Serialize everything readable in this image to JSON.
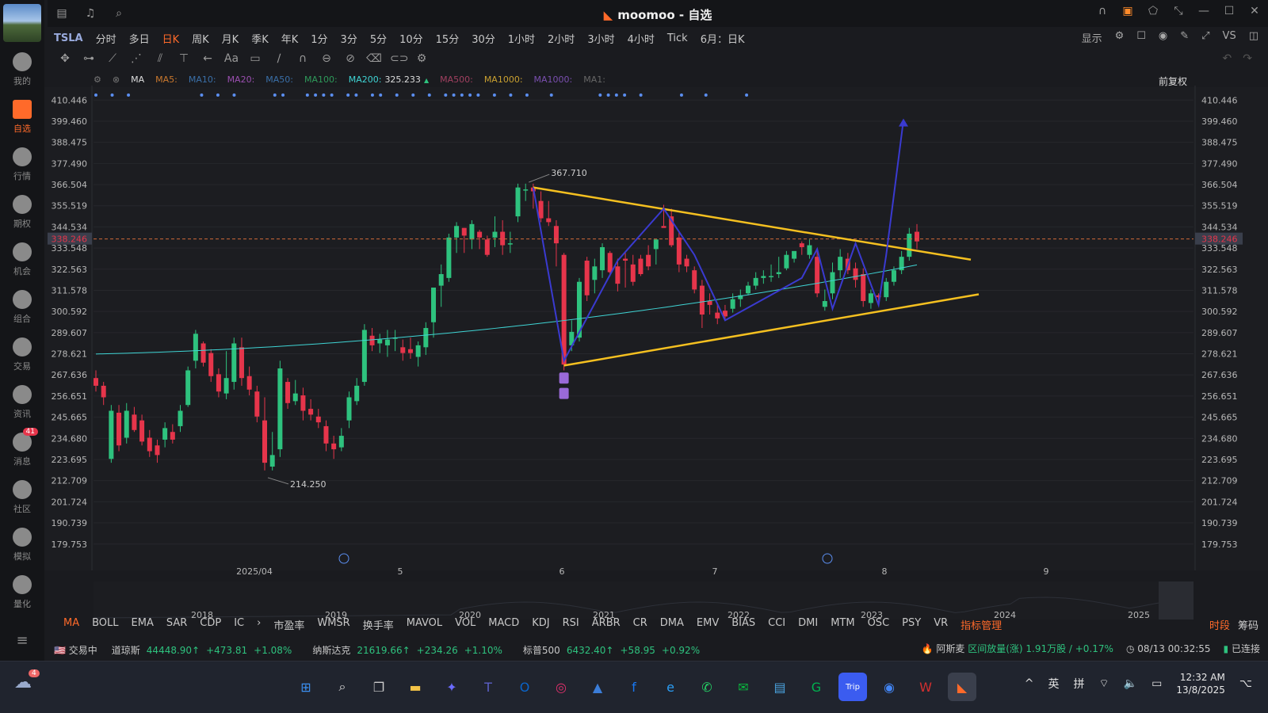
{
  "window": {
    "title": "moomoo - 自选",
    "logo": "moomoo-logo-icon"
  },
  "sidebar": {
    "items": [
      {
        "label": "我的",
        "icon": "user-icon"
      },
      {
        "label": "自选",
        "icon": "watchlist-bar-icon",
        "active": true
      },
      {
        "label": "行情",
        "icon": "market-icon"
      },
      {
        "label": "期权",
        "icon": "options-icon"
      },
      {
        "label": "机会",
        "icon": "funnel-icon"
      },
      {
        "label": "组合",
        "icon": "pie-icon"
      },
      {
        "label": "交易",
        "icon": "trade-icon"
      },
      {
        "label": "资讯",
        "icon": "news-icon"
      },
      {
        "label": "消息",
        "icon": "message-icon",
        "badge": "41"
      },
      {
        "label": "社区",
        "icon": "community-icon"
      },
      {
        "label": "模拟",
        "icon": "game-icon"
      },
      {
        "label": "量化",
        "icon": "code-icon"
      }
    ]
  },
  "toolbar": {
    "symbol": "TSLA",
    "timeframes": [
      "分时",
      "多日",
      "日K",
      "周K",
      "月K",
      "季K",
      "年K",
      "1分",
      "3分",
      "5分",
      "10分",
      "15分",
      "30分",
      "1小时",
      "2小时",
      "3小时",
      "4小时",
      "Tick",
      "6月：日K"
    ],
    "active_timeframe": "日K",
    "display_label": "显示",
    "vs_label": "VS"
  },
  "ma_legend": {
    "ma_label": "MA",
    "items": [
      {
        "label": "MA5:",
        "color": "#c9782e"
      },
      {
        "label": "MA10:",
        "color": "#3a6fa8"
      },
      {
        "label": "MA20:",
        "color": "#9a4fb0"
      },
      {
        "label": "MA50:",
        "color": "#3a6fa8"
      },
      {
        "label": "MA100:",
        "color": "#2e9a5a"
      },
      {
        "label": "MA200:",
        "value": "325.233",
        "color": "#3fd4d4",
        "arrow": "▲"
      },
      {
        "label": "MA500:",
        "color": "#a04060"
      },
      {
        "label": "MA1000:",
        "color": "#c9a030"
      },
      {
        "label": "MA1000:",
        "color": "#7a4fb0"
      },
      {
        "label": "MA1:",
        "color": "#666"
      }
    ],
    "adjust_label": "前复权"
  },
  "chart_data": {
    "type": "candlestick",
    "price_axis": [
      "410.446",
      "399.460",
      "388.475",
      "377.490",
      "366.504",
      "355.519",
      "344.534",
      "333.548",
      "322.563",
      "311.578",
      "300.592",
      "289.607",
      "278.621",
      "267.636",
      "256.651",
      "245.665",
      "234.680",
      "223.695",
      "212.709",
      "201.724",
      "190.739",
      "179.753"
    ],
    "ylim": [
      174.3,
      415.9
    ],
    "current_price": "338.246",
    "x_labels": [
      "2025/04",
      "5",
      "6",
      "7",
      "8",
      "9"
    ],
    "annotations": {
      "high": "367.710",
      "low": "214.250"
    },
    "candles": [
      [
        266,
        262,
        259,
        270
      ],
      [
        262,
        256,
        252,
        264
      ],
      [
        224,
        249,
        222,
        252
      ],
      [
        248,
        231,
        228,
        252
      ],
      [
        235,
        249,
        232,
        253
      ],
      [
        247,
        239,
        238,
        251
      ],
      [
        244,
        233,
        231,
        247
      ],
      [
        235,
        228,
        225,
        239
      ],
      [
        231,
        226,
        222,
        234
      ],
      [
        234,
        240,
        230,
        243
      ],
      [
        238,
        234,
        232,
        242
      ],
      [
        241,
        249,
        238,
        252
      ],
      [
        252,
        270,
        251,
        272
      ],
      [
        275,
        289,
        271,
        291
      ],
      [
        284,
        274,
        272,
        285
      ],
      [
        279,
        267,
        264,
        281
      ],
      [
        268,
        259,
        256,
        271
      ],
      [
        258,
        266,
        255,
        280
      ],
      [
        264,
        284,
        260,
        287
      ],
      [
        282,
        266,
        262,
        287
      ],
      [
        267,
        260,
        257,
        272
      ],
      [
        259,
        246,
        243,
        262
      ],
      [
        244,
        222,
        218,
        256
      ],
      [
        220,
        226,
        218,
        238
      ],
      [
        229,
        271,
        225,
        275
      ],
      [
        264,
        253,
        250,
        266
      ],
      [
        254,
        258,
        252,
        265
      ],
      [
        257,
        249,
        244,
        261
      ],
      [
        250,
        247,
        244,
        255
      ],
      [
        246,
        243,
        240,
        250
      ],
      [
        241,
        232,
        228,
        244
      ],
      [
        232,
        229,
        224,
        236
      ],
      [
        230,
        236,
        228,
        240
      ],
      [
        244,
        256,
        240,
        259
      ],
      [
        254,
        262,
        252,
        266
      ],
      [
        264,
        291,
        262,
        294
      ],
      [
        288,
        283,
        280,
        292
      ],
      [
        284,
        286,
        279,
        289
      ],
      [
        283,
        286,
        277,
        291
      ],
      [
        287,
        287,
        280,
        291
      ],
      [
        282,
        279,
        275,
        286
      ],
      [
        281,
        279,
        276,
        287
      ],
      [
        277,
        283,
        272,
        285
      ],
      [
        282,
        292,
        278,
        295
      ],
      [
        295,
        313,
        287,
        303
      ],
      [
        314,
        320,
        303,
        325
      ],
      [
        318,
        339,
        316,
        341
      ],
      [
        339,
        345,
        331,
        347
      ],
      [
        344,
        340,
        331,
        344
      ],
      [
        338,
        346,
        333,
        348
      ],
      [
        342,
        339,
        333,
        343
      ],
      [
        338,
        330,
        329,
        340
      ],
      [
        339,
        342,
        334,
        350
      ],
      [
        342,
        335,
        330,
        348
      ],
      [
        336,
        336,
        331,
        342
      ],
      [
        350,
        365,
        347,
        367
      ],
      [
        364,
        364,
        358,
        367
      ],
      [
        365,
        363,
        354,
        367
      ],
      [
        358,
        349,
        347,
        363
      ],
      [
        349,
        347,
        345,
        358
      ],
      [
        345,
        336,
        324,
        348
      ],
      [
        330,
        273,
        270,
        331
      ],
      [
        283,
        290,
        280,
        296
      ],
      [
        287,
        316,
        285,
        318
      ],
      [
        327,
        309,
        306,
        329
      ],
      [
        317,
        324,
        310,
        328
      ],
      [
        322,
        334,
        318,
        336
      ],
      [
        331,
        321,
        319,
        332
      ],
      [
        324,
        315,
        311,
        328
      ],
      [
        328,
        327,
        313,
        331
      ],
      [
        325,
        316,
        314,
        330
      ],
      [
        328,
        320,
        319,
        330
      ],
      [
        330,
        324,
        322,
        335
      ],
      [
        333,
        338,
        325,
        338
      ],
      [
        345,
        344,
        345,
        356
      ],
      [
        350,
        335,
        334,
        354
      ],
      [
        339,
        325,
        321,
        342
      ],
      [
        328,
        324,
        321,
        330
      ],
      [
        322,
        312,
        310,
        324
      ],
      [
        314,
        299,
        292,
        317
      ],
      [
        306,
        304,
        299,
        310
      ],
      [
        300,
        297,
        294,
        305
      ],
      [
        301,
        298,
        296,
        304
      ],
      [
        302,
        307,
        300,
        310
      ],
      [
        307,
        309,
        303,
        312
      ],
      [
        310,
        314,
        309,
        316
      ],
      [
        314,
        318,
        312,
        321
      ],
      [
        318,
        319,
        315,
        322
      ],
      [
        319,
        319,
        316,
        325
      ],
      [
        320,
        321,
        318,
        329
      ],
      [
        323,
        330,
        322,
        332
      ],
      [
        328,
        332,
        326,
        331
      ],
      [
        336,
        334,
        330,
        337
      ],
      [
        330,
        335,
        328,
        338
      ],
      [
        329,
        310,
        308,
        332
      ],
      [
        303,
        306,
        301,
        312
      ],
      [
        310,
        321,
        307,
        326
      ],
      [
        322,
        329,
        318,
        333
      ],
      [
        328,
        322,
        320,
        331
      ],
      [
        323,
        317,
        313,
        326
      ],
      [
        320,
        306,
        303,
        323
      ],
      [
        305,
        310,
        302,
        312
      ],
      [
        309,
        308,
        305,
        310
      ],
      [
        308,
        316,
        306,
        318
      ],
      [
        316,
        322,
        314,
        324
      ],
      [
        322,
        329,
        320,
        332
      ],
      [
        329,
        341,
        327,
        344
      ],
      [
        342,
        337,
        333,
        346
      ]
    ]
  },
  "indicator_tabs": {
    "items": [
      "MA",
      "BOLL",
      "EMA",
      "SAR",
      "CDP",
      "IC",
      "›",
      "市盈率",
      "WMSR",
      "换手率",
      "MAVOL",
      "VOL",
      "MACD",
      "KDJ",
      "RSI",
      "ARBR",
      "CR",
      "DMA",
      "EMV",
      "BIAS",
      "CCI",
      "DMI",
      "MTM",
      "OSC",
      "PSY",
      "VR"
    ],
    "manage_label": "指标管理",
    "right": [
      "时段",
      "筹码"
    ]
  },
  "nav_years": [
    "2018",
    "2019",
    "2020",
    "2021",
    "2022",
    "2023",
    "2024",
    "2025"
  ],
  "statusbar": {
    "market": "交易中",
    "indices": [
      {
        "name": "道琼斯",
        "value": "44448.90↑",
        "change": "+473.81",
        "pct": "+1.08%"
      },
      {
        "name": "纳斯达克",
        "value": "21619.66↑",
        "change": "+234.26",
        "pct": "+1.10%"
      },
      {
        "name": "标普500",
        "value": "6432.40↑",
        "change": "+58.95",
        "pct": "+0.92%"
      }
    ],
    "news_name": "阿斯麦",
    "news_text": "区间放量(涨) 1.91万股 / +0.17%",
    "time": "08/13 00:32:55",
    "connection": "已连接"
  },
  "taskbar": {
    "apps": [
      "windows-start-icon",
      "search-icon",
      "task-view-icon",
      "file-explorer-icon",
      "copilot-icon",
      "teams-icon",
      "outlook-icon",
      "instagram-icon",
      "photos-icon",
      "facebook-icon",
      "edge-icon",
      "whatsapp-icon",
      "wechat-icon",
      "notepad-icon",
      "grab-icon",
      "trip-icon",
      "chrome-icon",
      "wps-icon",
      "moomoo-icon"
    ],
    "trip_label": "Trip",
    "lang1": "英",
    "lang2": "拼",
    "time": "12:32 AM",
    "date": "13/8/2025",
    "weather_badge": "4"
  }
}
